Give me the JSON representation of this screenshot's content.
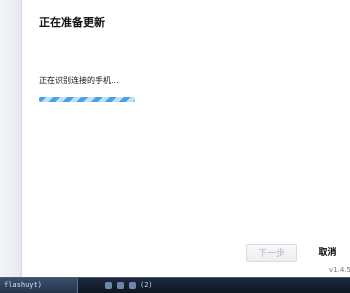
{
  "header": {
    "title": "正在准备更新"
  },
  "status": {
    "message": "正在识别连接的手机...",
    "progress_indeterminate": true
  },
  "buttons": {
    "next_label": "下一步",
    "cancel_label": "取消"
  },
  "footer": {
    "version": "v1.4.5"
  },
  "taskbar": {
    "task_label": "flashuyt)",
    "tray_text": "(2)"
  },
  "colors": {
    "progress_stripe": "#4aa3df",
    "progress_stripe_light": "#bfe0f7",
    "taskbar": "#0e1622"
  }
}
